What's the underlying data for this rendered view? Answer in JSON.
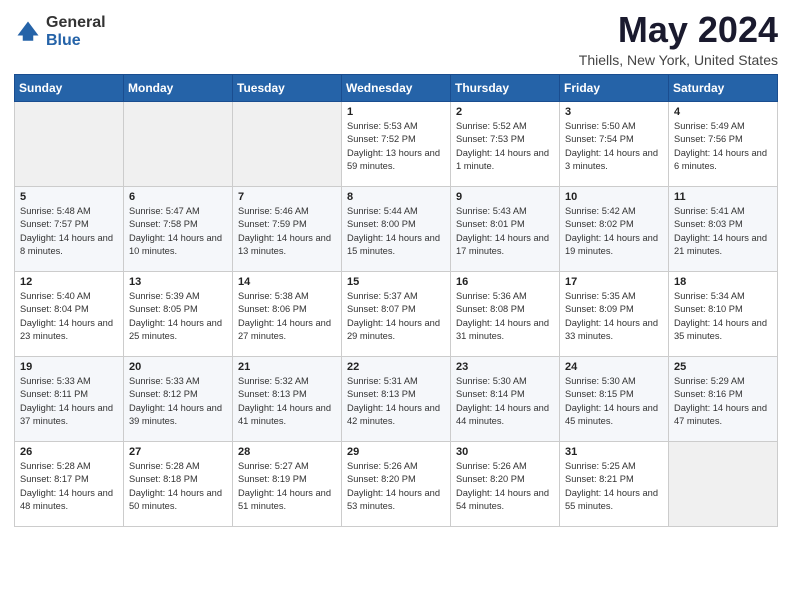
{
  "header": {
    "logo_general": "General",
    "logo_blue": "Blue",
    "month_title": "May 2024",
    "location": "Thiells, New York, United States"
  },
  "days_of_week": [
    "Sunday",
    "Monday",
    "Tuesday",
    "Wednesday",
    "Thursday",
    "Friday",
    "Saturday"
  ],
  "weeks": [
    [
      {
        "num": "",
        "sunrise": "",
        "sunset": "",
        "daylight": "",
        "empty": true
      },
      {
        "num": "",
        "sunrise": "",
        "sunset": "",
        "daylight": "",
        "empty": true
      },
      {
        "num": "",
        "sunrise": "",
        "sunset": "",
        "daylight": "",
        "empty": true
      },
      {
        "num": "1",
        "sunrise": "Sunrise: 5:53 AM",
        "sunset": "Sunset: 7:52 PM",
        "daylight": "Daylight: 13 hours and 59 minutes."
      },
      {
        "num": "2",
        "sunrise": "Sunrise: 5:52 AM",
        "sunset": "Sunset: 7:53 PM",
        "daylight": "Daylight: 14 hours and 1 minute."
      },
      {
        "num": "3",
        "sunrise": "Sunrise: 5:50 AM",
        "sunset": "Sunset: 7:54 PM",
        "daylight": "Daylight: 14 hours and 3 minutes."
      },
      {
        "num": "4",
        "sunrise": "Sunrise: 5:49 AM",
        "sunset": "Sunset: 7:56 PM",
        "daylight": "Daylight: 14 hours and 6 minutes."
      }
    ],
    [
      {
        "num": "5",
        "sunrise": "Sunrise: 5:48 AM",
        "sunset": "Sunset: 7:57 PM",
        "daylight": "Daylight: 14 hours and 8 minutes."
      },
      {
        "num": "6",
        "sunrise": "Sunrise: 5:47 AM",
        "sunset": "Sunset: 7:58 PM",
        "daylight": "Daylight: 14 hours and 10 minutes."
      },
      {
        "num": "7",
        "sunrise": "Sunrise: 5:46 AM",
        "sunset": "Sunset: 7:59 PM",
        "daylight": "Daylight: 14 hours and 13 minutes."
      },
      {
        "num": "8",
        "sunrise": "Sunrise: 5:44 AM",
        "sunset": "Sunset: 8:00 PM",
        "daylight": "Daylight: 14 hours and 15 minutes."
      },
      {
        "num": "9",
        "sunrise": "Sunrise: 5:43 AM",
        "sunset": "Sunset: 8:01 PM",
        "daylight": "Daylight: 14 hours and 17 minutes."
      },
      {
        "num": "10",
        "sunrise": "Sunrise: 5:42 AM",
        "sunset": "Sunset: 8:02 PM",
        "daylight": "Daylight: 14 hours and 19 minutes."
      },
      {
        "num": "11",
        "sunrise": "Sunrise: 5:41 AM",
        "sunset": "Sunset: 8:03 PM",
        "daylight": "Daylight: 14 hours and 21 minutes."
      }
    ],
    [
      {
        "num": "12",
        "sunrise": "Sunrise: 5:40 AM",
        "sunset": "Sunset: 8:04 PM",
        "daylight": "Daylight: 14 hours and 23 minutes."
      },
      {
        "num": "13",
        "sunrise": "Sunrise: 5:39 AM",
        "sunset": "Sunset: 8:05 PM",
        "daylight": "Daylight: 14 hours and 25 minutes."
      },
      {
        "num": "14",
        "sunrise": "Sunrise: 5:38 AM",
        "sunset": "Sunset: 8:06 PM",
        "daylight": "Daylight: 14 hours and 27 minutes."
      },
      {
        "num": "15",
        "sunrise": "Sunrise: 5:37 AM",
        "sunset": "Sunset: 8:07 PM",
        "daylight": "Daylight: 14 hours and 29 minutes."
      },
      {
        "num": "16",
        "sunrise": "Sunrise: 5:36 AM",
        "sunset": "Sunset: 8:08 PM",
        "daylight": "Daylight: 14 hours and 31 minutes."
      },
      {
        "num": "17",
        "sunrise": "Sunrise: 5:35 AM",
        "sunset": "Sunset: 8:09 PM",
        "daylight": "Daylight: 14 hours and 33 minutes."
      },
      {
        "num": "18",
        "sunrise": "Sunrise: 5:34 AM",
        "sunset": "Sunset: 8:10 PM",
        "daylight": "Daylight: 14 hours and 35 minutes."
      }
    ],
    [
      {
        "num": "19",
        "sunrise": "Sunrise: 5:33 AM",
        "sunset": "Sunset: 8:11 PM",
        "daylight": "Daylight: 14 hours and 37 minutes."
      },
      {
        "num": "20",
        "sunrise": "Sunrise: 5:33 AM",
        "sunset": "Sunset: 8:12 PM",
        "daylight": "Daylight: 14 hours and 39 minutes."
      },
      {
        "num": "21",
        "sunrise": "Sunrise: 5:32 AM",
        "sunset": "Sunset: 8:13 PM",
        "daylight": "Daylight: 14 hours and 41 minutes."
      },
      {
        "num": "22",
        "sunrise": "Sunrise: 5:31 AM",
        "sunset": "Sunset: 8:13 PM",
        "daylight": "Daylight: 14 hours and 42 minutes."
      },
      {
        "num": "23",
        "sunrise": "Sunrise: 5:30 AM",
        "sunset": "Sunset: 8:14 PM",
        "daylight": "Daylight: 14 hours and 44 minutes."
      },
      {
        "num": "24",
        "sunrise": "Sunrise: 5:30 AM",
        "sunset": "Sunset: 8:15 PM",
        "daylight": "Daylight: 14 hours and 45 minutes."
      },
      {
        "num": "25",
        "sunrise": "Sunrise: 5:29 AM",
        "sunset": "Sunset: 8:16 PM",
        "daylight": "Daylight: 14 hours and 47 minutes."
      }
    ],
    [
      {
        "num": "26",
        "sunrise": "Sunrise: 5:28 AM",
        "sunset": "Sunset: 8:17 PM",
        "daylight": "Daylight: 14 hours and 48 minutes."
      },
      {
        "num": "27",
        "sunrise": "Sunrise: 5:28 AM",
        "sunset": "Sunset: 8:18 PM",
        "daylight": "Daylight: 14 hours and 50 minutes."
      },
      {
        "num": "28",
        "sunrise": "Sunrise: 5:27 AM",
        "sunset": "Sunset: 8:19 PM",
        "daylight": "Daylight: 14 hours and 51 minutes."
      },
      {
        "num": "29",
        "sunrise": "Sunrise: 5:26 AM",
        "sunset": "Sunset: 8:20 PM",
        "daylight": "Daylight: 14 hours and 53 minutes."
      },
      {
        "num": "30",
        "sunrise": "Sunrise: 5:26 AM",
        "sunset": "Sunset: 8:20 PM",
        "daylight": "Daylight: 14 hours and 54 minutes."
      },
      {
        "num": "31",
        "sunrise": "Sunrise: 5:25 AM",
        "sunset": "Sunset: 8:21 PM",
        "daylight": "Daylight: 14 hours and 55 minutes."
      },
      {
        "num": "",
        "sunrise": "",
        "sunset": "",
        "daylight": "",
        "empty": true
      }
    ]
  ]
}
